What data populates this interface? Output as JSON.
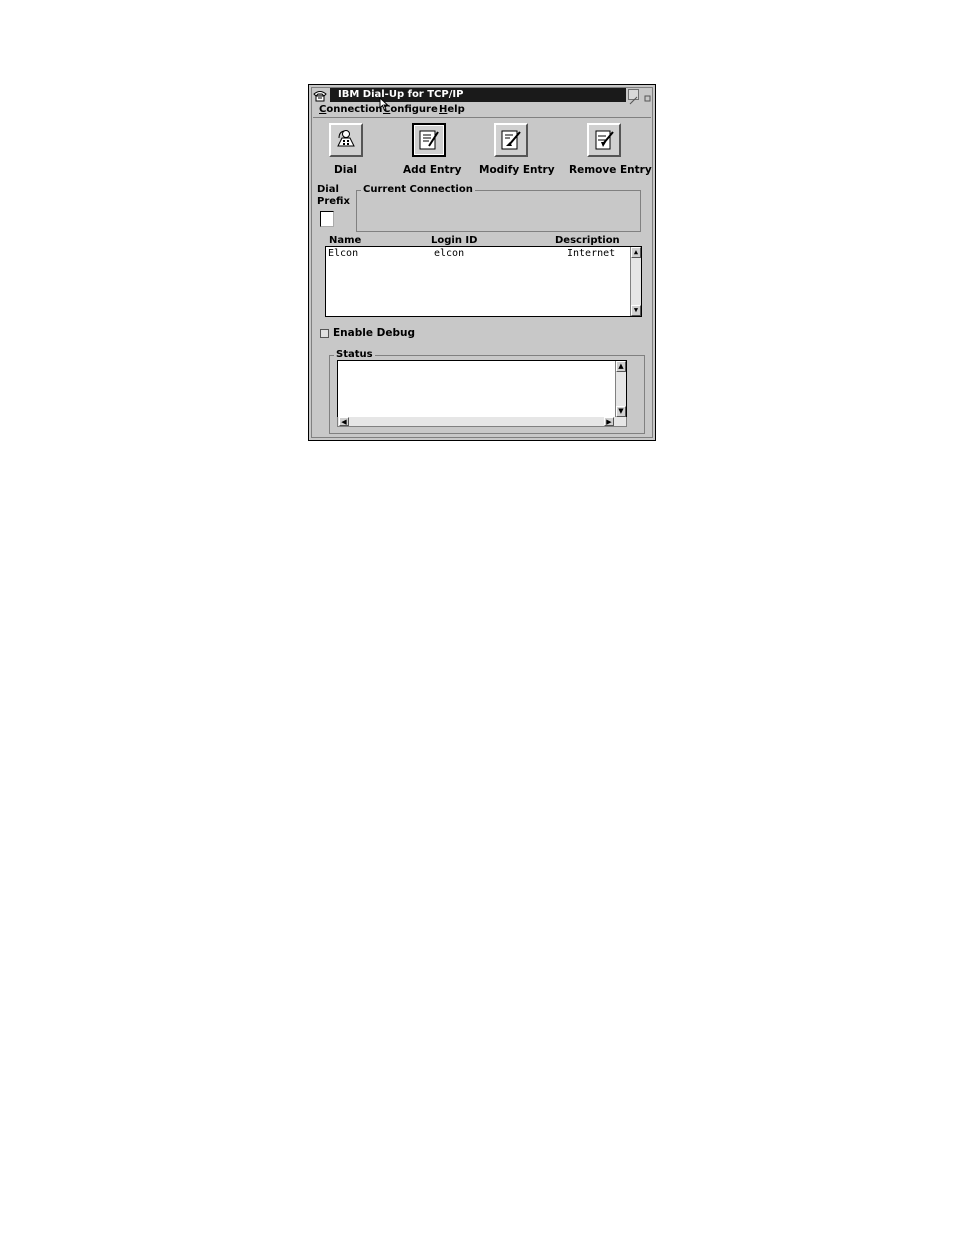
{
  "window": {
    "title": "IBM Dial-Up for TCP/IP"
  },
  "menu": {
    "connection": {
      "mnemonic": "C",
      "rest": "onnection"
    },
    "configure": {
      "mnemonic": "C",
      "rest": "onfigure"
    },
    "help": {
      "mnemonic": "H",
      "rest": "elp"
    }
  },
  "toolbar": {
    "dial": "Dial",
    "add_entry": "Add Entry",
    "modify_entry": "Modify Entry",
    "remove_entry": "Remove Entry"
  },
  "dial_prefix": {
    "line1": "Dial",
    "line2": "Prefix"
  },
  "current_connection": {
    "label": "Current Connection"
  },
  "list": {
    "headers": [
      "Name",
      "Login ID",
      "Description"
    ],
    "rows": [
      [
        "Elcon",
        "elcon",
        "Internet"
      ]
    ]
  },
  "enable_debug": {
    "label": "Enable Debug",
    "checked": false
  },
  "status": {
    "label": "Status"
  }
}
